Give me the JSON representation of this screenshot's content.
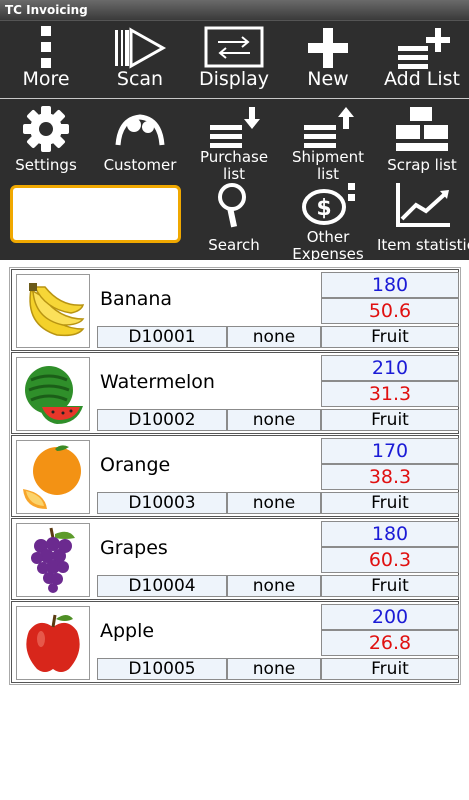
{
  "app": {
    "title": "TC Invoicing"
  },
  "toolbar1": [
    {
      "label": "More",
      "icon": "more-icon"
    },
    {
      "label": "Scan",
      "icon": "scan-icon"
    },
    {
      "label": "Display",
      "icon": "display-icon"
    },
    {
      "label": "New",
      "icon": "plus-icon"
    },
    {
      "label": "Add List",
      "icon": "add-list-icon"
    }
  ],
  "toolbar2": [
    {
      "label": "Settings",
      "icon": "gear-icon"
    },
    {
      "label": "Customer",
      "icon": "customer-icon"
    },
    {
      "label": "Purchase list",
      "icon": "purchase-list-icon"
    },
    {
      "label": "Shipment list",
      "icon": "shipment-list-icon"
    },
    {
      "label": "Scrap list",
      "icon": "scrap-list-icon"
    },
    {
      "label": "Search",
      "icon": "search-icon"
    },
    {
      "label": "Other Expenses",
      "icon": "dollar-icon"
    },
    {
      "label": "Item statistics",
      "icon": "chart-icon"
    }
  ],
  "search": {
    "value": ""
  },
  "items": [
    {
      "name": "Banana",
      "code": "D10001",
      "tag": "none",
      "qty": "180",
      "price": "50.6",
      "category": "Fruit"
    },
    {
      "name": "Watermelon",
      "code": "D10002",
      "tag": "none",
      "qty": "210",
      "price": "31.3",
      "category": "Fruit"
    },
    {
      "name": "Orange",
      "code": "D10003",
      "tag": "none",
      "qty": "170",
      "price": "38.3",
      "category": "Fruit"
    },
    {
      "name": "Grapes",
      "code": "D10004",
      "tag": "none",
      "qty": "180",
      "price": "60.3",
      "category": "Fruit"
    },
    {
      "name": "Apple",
      "code": "D10005",
      "tag": "none",
      "qty": "200",
      "price": "26.8",
      "category": "Fruit"
    }
  ],
  "colors": {
    "accent": "#f0a800",
    "quantity": "#1b1bd6",
    "price": "#e01010",
    "toolbar": "#2e2e2e"
  }
}
